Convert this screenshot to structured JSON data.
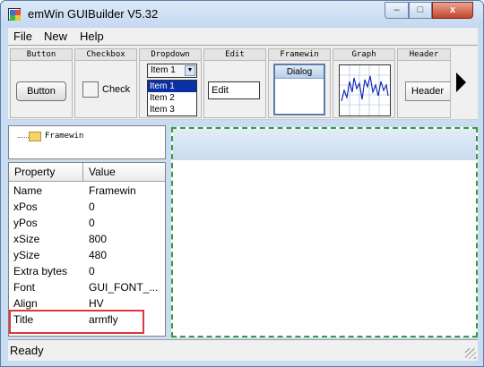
{
  "window": {
    "title": "emWin GUIBuilder V5.32"
  },
  "window_controls": {
    "minimize": "–",
    "maximize": "□",
    "close": "x"
  },
  "menu": [
    "File",
    "New",
    "Help"
  ],
  "toolbar": {
    "button": {
      "header": "Button",
      "sample": "Button"
    },
    "checkbox": {
      "header": "Checkbox",
      "sample": "Check"
    },
    "dropdown": {
      "header": "Dropdown",
      "selected": "Item 1",
      "options": [
        "Item 1",
        "Item 2",
        "Item 3"
      ]
    },
    "edit": {
      "header": "Edit",
      "sample": "Edit"
    },
    "framewin": {
      "header": "Framewin",
      "sample": "Dialog"
    },
    "graph": {
      "header": "Graph"
    },
    "header": {
      "header": "Header",
      "sample": "Header"
    }
  },
  "tree": {
    "root": "Framewin"
  },
  "properties": {
    "columns": [
      "Property",
      "Value"
    ],
    "rows": [
      {
        "name": "Name",
        "value": "Framewin"
      },
      {
        "name": "xPos",
        "value": "0"
      },
      {
        "name": "yPos",
        "value": "0"
      },
      {
        "name": "xSize",
        "value": "800"
      },
      {
        "name": "ySize",
        "value": "480"
      },
      {
        "name": "Extra bytes",
        "value": "0"
      },
      {
        "name": "Font",
        "value": "GUI_FONT_..."
      },
      {
        "name": "Align",
        "value": "HV"
      },
      {
        "name": "Title",
        "value": "armfly"
      }
    ],
    "highlighted_row": "Title"
  },
  "status": {
    "text": "Ready"
  },
  "colors": {
    "highlight": "#e0353b",
    "selection": "#0a2fa6",
    "design_border": "#3a9a3a"
  }
}
